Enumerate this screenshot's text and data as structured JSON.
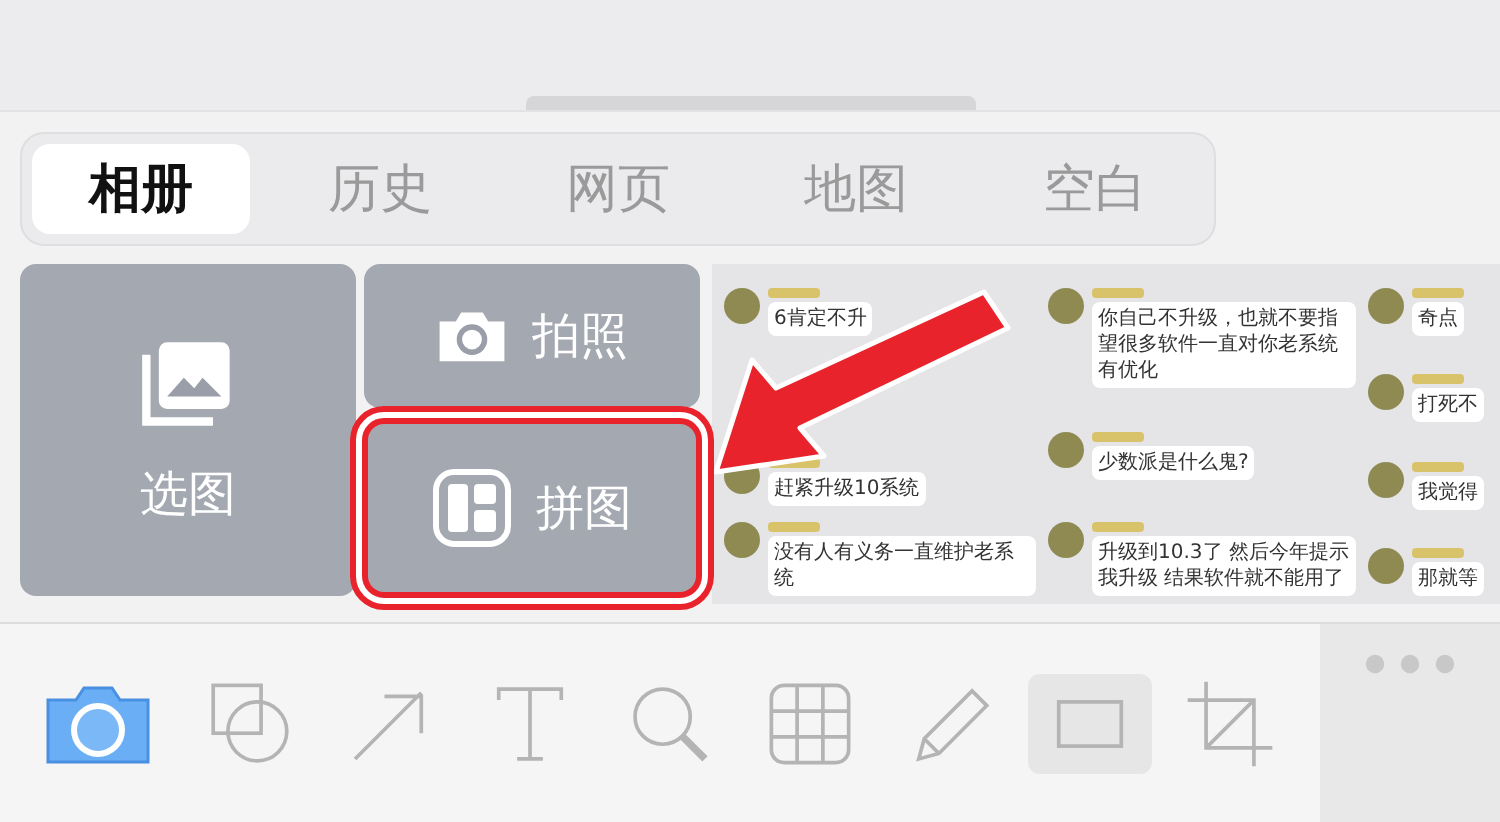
{
  "tabs": [
    {
      "label": "相册",
      "selected": true
    },
    {
      "label": "历史",
      "selected": false
    },
    {
      "label": "网页",
      "selected": false
    },
    {
      "label": "地图",
      "selected": false
    },
    {
      "label": "空白",
      "selected": false
    }
  ],
  "actions": [
    {
      "kind": "album",
      "label": "选图",
      "highlighted": false
    },
    {
      "kind": "camera",
      "label": "拍照",
      "highlighted": false
    },
    {
      "kind": "collage",
      "label": "拼图",
      "highlighted": true
    }
  ],
  "chat_columns": [
    [
      {
        "text": "6肯定不升"
      },
      {
        "text": "赶紧升级10系统"
      },
      {
        "text": "没有人有义务一直维护老系统"
      }
    ],
    [
      {
        "text": "你自己不升级，也就不要指望很多软件一直对你老系统有优化"
      },
      {
        "text": "少数派是什么鬼?"
      },
      {
        "text": "升级到10.3了 然后今年提示我升级 结果软件就不能用了"
      }
    ],
    [
      {
        "text": "奇点"
      },
      {
        "text": "打死不"
      },
      {
        "text": "我觉得"
      },
      {
        "text": "那就等"
      }
    ]
  ],
  "toolbar": {
    "tools": [
      {
        "kind": "shapes",
        "selected": false
      },
      {
        "kind": "arrow",
        "selected": false
      },
      {
        "kind": "text",
        "selected": false
      },
      {
        "kind": "magnifier",
        "selected": false
      },
      {
        "kind": "grid",
        "selected": false
      },
      {
        "kind": "pencil",
        "selected": false
      },
      {
        "kind": "rectangle",
        "selected": true
      },
      {
        "kind": "crop",
        "selected": false
      }
    ]
  }
}
